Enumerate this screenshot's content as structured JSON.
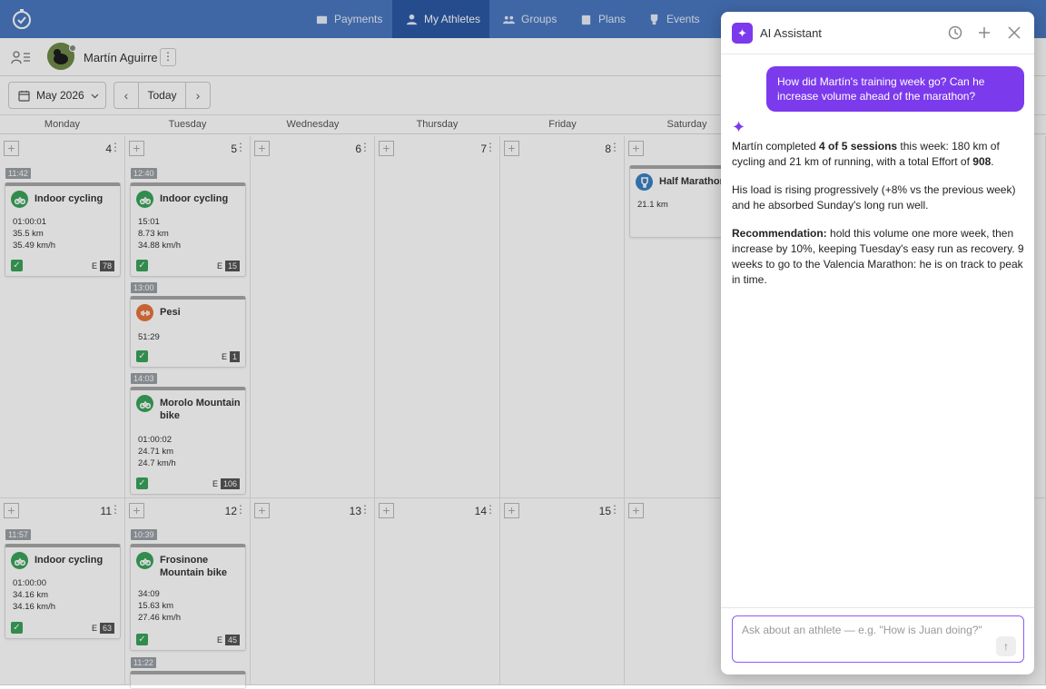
{
  "nav": {
    "tabs": [
      {
        "label": "Payments",
        "icon": "card-icon"
      },
      {
        "label": "My Athletes",
        "icon": "person-icon",
        "active": true
      },
      {
        "label": "Groups",
        "icon": "group-icon"
      },
      {
        "label": "Plans",
        "icon": "clipboard-icon"
      },
      {
        "label": "Events",
        "icon": "trophy-icon"
      }
    ]
  },
  "athlete": {
    "name": "Martín Aguirre",
    "menu": "⋮"
  },
  "toolbar": {
    "month": "May 2026",
    "today": "Today",
    "prev": "‹",
    "next": "›"
  },
  "days": [
    "Monday",
    "Tuesday",
    "Wednesday",
    "Thursday",
    "Friday",
    "Saturday"
  ],
  "week1": {
    "dates": [
      "4",
      "5",
      "6",
      "7",
      "8"
    ],
    "mon": {
      "time": "11:42",
      "title": "Indoor cycling",
      "stats": [
        "01:00:01",
        "35.5 km",
        "35.49 km/h"
      ],
      "effort": "78"
    },
    "tue": [
      {
        "time": "12:40",
        "title": "Indoor cycling",
        "stats": [
          "15:01",
          "8.73 km",
          "34.88 km/h"
        ],
        "effort": "15"
      },
      {
        "time": "13:00",
        "title": "Pesi",
        "stats": [
          "51:29"
        ],
        "effort": "1"
      },
      {
        "time": "14:03",
        "title": "Morolo Mountain bike",
        "stats": [
          "01:00:02",
          "24.71 km",
          "24.7 km/h"
        ],
        "effort": "106"
      }
    ],
    "sat": {
      "title": "Half Marathon",
      "stats": [
        "21.1 km"
      ]
    }
  },
  "week2": {
    "dates": [
      "11",
      "12",
      "13",
      "14",
      "15"
    ],
    "mon": {
      "time": "11:57",
      "title": "Indoor cycling",
      "stats": [
        "01:00:00",
        "34.16 km",
        "34.16 km/h"
      ],
      "effort": "63"
    },
    "tue": [
      {
        "time": "10:39",
        "title": "Frosinone Mountain bike",
        "stats": [
          "34:09",
          "15.63 km",
          "27.46 km/h"
        ],
        "effort": "45"
      },
      {
        "time": "11:22"
      }
    ]
  },
  "effort_prefix": "E",
  "panel": {
    "title": "AI Assistant",
    "user_message": "How did Martín's training week go? Can he increase volume ahead of the marathon?",
    "reply": {
      "p1_a": "Martín completed ",
      "p1_b": "4 of 5 sessions",
      "p1_c": " this week: 180 km of cycling and 21 km of running, with a total Effort of ",
      "p1_d": "908",
      "p1_e": ".",
      "p2": "His load is rising progressively (+8% vs the previous week) and he absorbed Sunday's long run well.",
      "p3_a": "Recommendation:",
      "p3_b": " hold this volume one more week, then increase by 10%, keeping Tuesday's easy run as recovery. 9 weeks to go to the Valencia Marathon: he is on track to peak in time."
    },
    "composer_placeholder": "Ask about an athlete — e.g. \"How is Juan doing?\"",
    "send": "↑"
  },
  "colors": {
    "nav": "#4a78c2",
    "nav_active": "#2c5aa6",
    "accent": "#7c3aed",
    "check": "#3aa35a",
    "cycling": "#3aa35a",
    "strength": "#e8743b",
    "race": "#3b82c4"
  }
}
